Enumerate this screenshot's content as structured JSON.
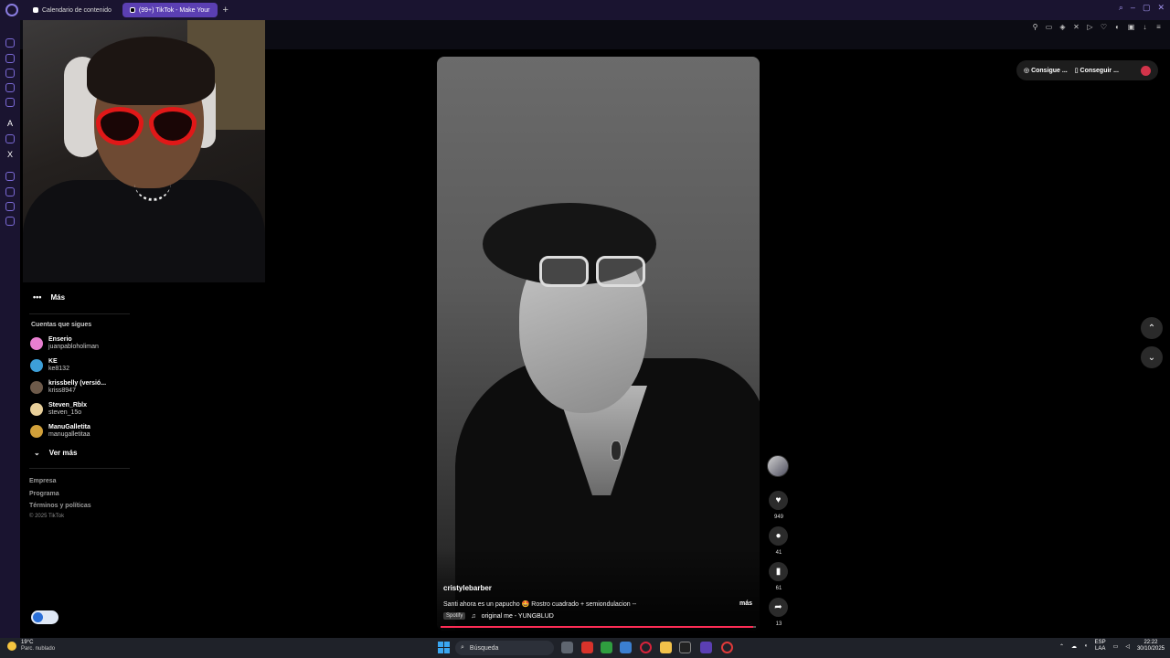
{
  "browser": {
    "tabs": [
      {
        "label": "Calendario de contenido"
      },
      {
        "label": "(99+) TikTok - Make Your"
      }
    ],
    "new_tab": "+"
  },
  "sidebar": {
    "more_label": "Más",
    "following_title": "Cuentas que sigues",
    "accounts": [
      {
        "name": "Enserio",
        "handle": "juanpabloholiman",
        "color": "#e77fd0"
      },
      {
        "name": "KE",
        "handle": "ke8132",
        "color": "#3d9fd8"
      },
      {
        "name": "krissbelly (versió...",
        "handle": "kriss8947",
        "color": "#6d5a4a"
      },
      {
        "name": "Steven_Rblx",
        "handle": "steven_15o",
        "color": "#e8cf9a"
      },
      {
        "name": "ManuGalletita",
        "handle": "manugalletitaa",
        "color": "#d1a03a"
      }
    ],
    "see_more": "Ver más",
    "footer": [
      "Empresa",
      "Programa",
      "Términos y políticas"
    ],
    "copyright": "© 2025 TikTok"
  },
  "video": {
    "author": "cristylebarber",
    "description": "Santi ahora es un papucho 🤩 Rostro cuadrado + semiondulacion --",
    "more": "más",
    "spotify": "Spotify",
    "music": "original me - YUNGBLUD",
    "progress": 0.99
  },
  "actions": {
    "likes": "949",
    "comments": "41",
    "saves": "61",
    "shares": "13"
  },
  "get_app": {
    "item1": "Consigue ...",
    "item2": "Conseguir ..."
  },
  "taskbar": {
    "temp": "19°C",
    "weather": "Parc. nublado",
    "search": "Búsqueda",
    "lang1": "ESP",
    "lang2": "LAA",
    "time": "22:22",
    "date": "30/10/2025"
  },
  "icons": [
    "opera-logo-icon",
    "search-icon",
    "heart-icon",
    "comment-icon",
    "bookmark-icon",
    "share-icon",
    "chevron-up-icon",
    "chevron-down-icon",
    "music-note-icon",
    "windows-start-icon"
  ]
}
